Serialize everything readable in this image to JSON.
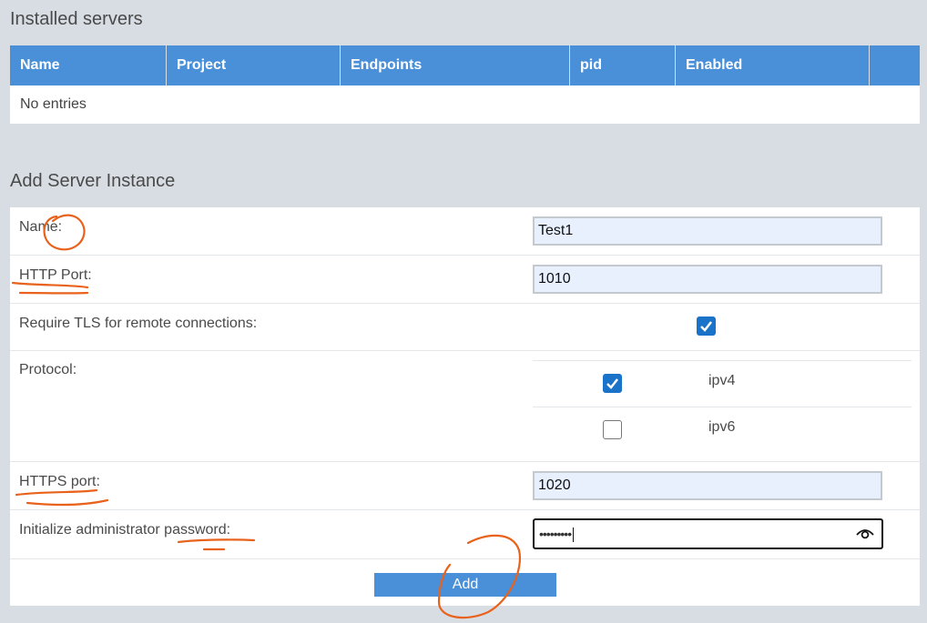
{
  "installed": {
    "title": "Installed servers",
    "columns": [
      "Name",
      "Project",
      "Endpoints",
      "pid",
      "Enabled",
      ""
    ],
    "empty_text": "No entries"
  },
  "add_instance": {
    "title": "Add Server Instance",
    "name_label": "Name:",
    "name_value": "Test1",
    "http_port_label": "HTTP Port:",
    "http_port_value": "1010",
    "tls_label": "Require TLS for remote connections:",
    "tls_checked": true,
    "protocol_label": "Protocol:",
    "protocols": [
      {
        "name": "ipv4",
        "checked": true
      },
      {
        "name": "ipv6",
        "checked": false
      }
    ],
    "https_port_label": "HTTPS port:",
    "https_port_value": "1020",
    "password_label": "Initialize administrator password:",
    "password_masked": "•••••••••",
    "add_button": "Add"
  },
  "colors": {
    "accent": "#4a90d9",
    "checkbox": "#1a73c9",
    "annotation": "#e8621c",
    "background": "#d8dde3"
  }
}
